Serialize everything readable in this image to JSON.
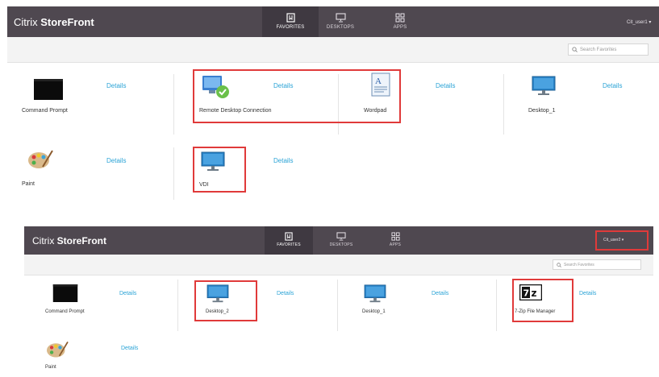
{
  "panel1": {
    "brand": {
      "prefix": "Citrix ",
      "bold": "StoreFront"
    },
    "tabs": [
      {
        "label": "FAVORITES",
        "icon": "bookmark-icon",
        "active": true
      },
      {
        "label": "DESKTOPS",
        "icon": "monitor-icon",
        "active": false
      },
      {
        "label": "APPS",
        "icon": "grid-icon",
        "active": false
      }
    ],
    "user": "Cit_user1 ▾",
    "search_placeholder": "Search Favorites",
    "details_label": "Details",
    "apps": [
      {
        "name": "Command Prompt",
        "icon": "command-prompt-icon"
      },
      {
        "name": "Remote Desktop Connection",
        "icon": "remote-desktop-icon"
      },
      {
        "name": "Wordpad",
        "icon": "wordpad-icon"
      },
      {
        "name": "Desktop_1",
        "icon": "monitor-icon"
      },
      {
        "name": "Paint",
        "icon": "paint-palette-icon"
      },
      {
        "name": "VDI",
        "icon": "monitor-icon"
      }
    ]
  },
  "panel2": {
    "brand": {
      "prefix": "Citrix ",
      "bold": "StoreFront"
    },
    "tabs": [
      {
        "label": "FAVORITES",
        "icon": "bookmark-icon",
        "active": true
      },
      {
        "label": "DESKTOPS",
        "icon": "monitor-icon",
        "active": false
      },
      {
        "label": "APPS",
        "icon": "grid-icon",
        "active": false
      }
    ],
    "user": "Cit_user2 ▾",
    "search_placeholder": "Search Favorites",
    "details_label": "Details",
    "apps": [
      {
        "name": "Command Prompt",
        "icon": "command-prompt-icon"
      },
      {
        "name": "Desktop_2",
        "icon": "monitor-icon"
      },
      {
        "name": "Desktop_1",
        "icon": "monitor-icon"
      },
      {
        "name": "7-Zip File Manager",
        "icon": "7zip-icon"
      },
      {
        "name": "Paint",
        "icon": "paint-palette-icon"
      }
    ]
  },
  "colors": {
    "header": "#4f4850",
    "active_tab": "#3f3941",
    "details": "#2aa3d6",
    "highlight": "#e03a3a"
  }
}
